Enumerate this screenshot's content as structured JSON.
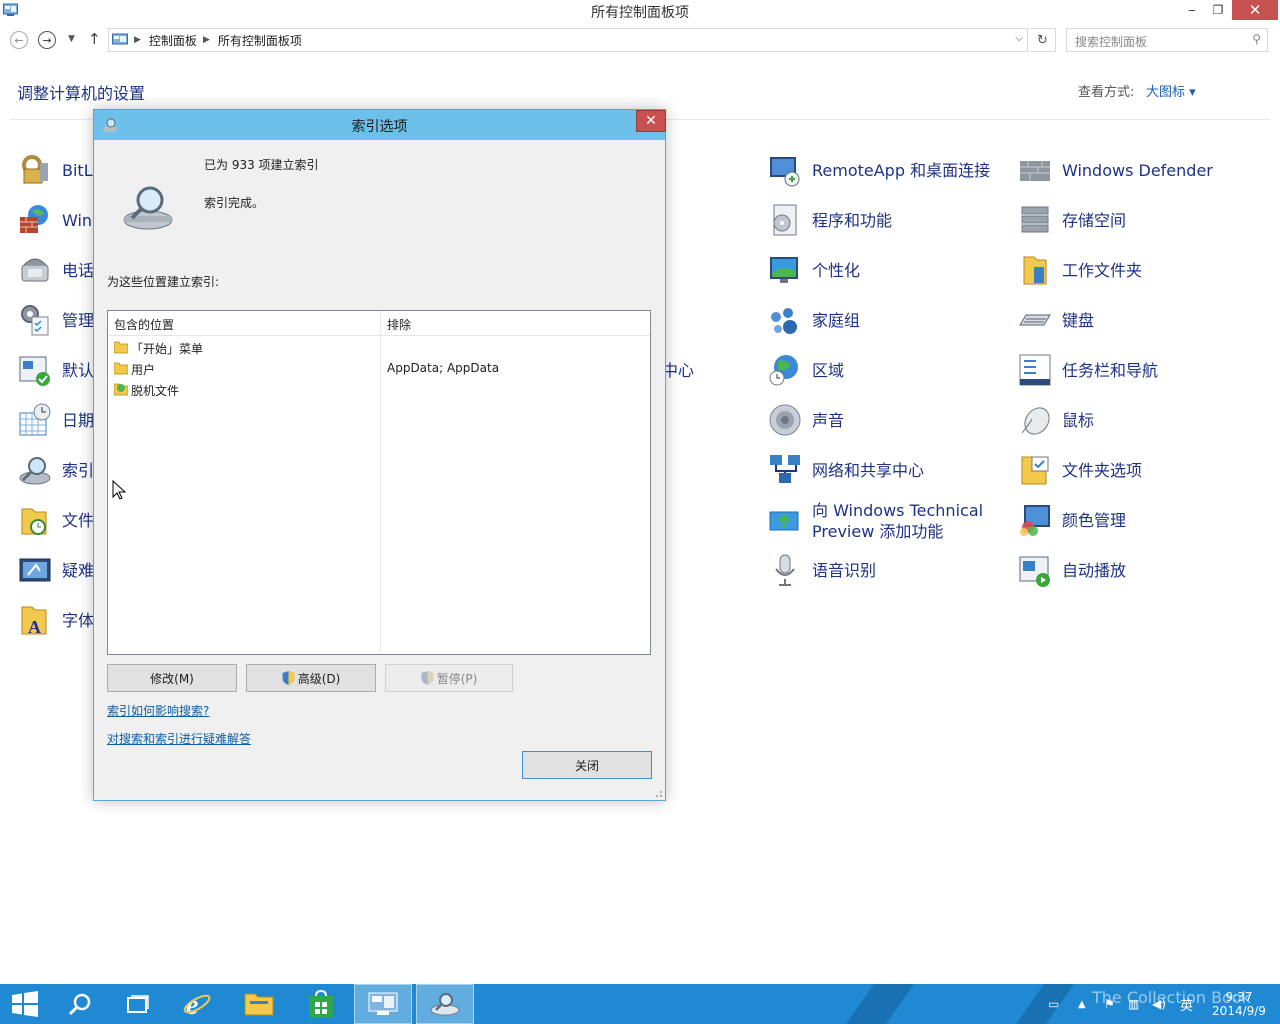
{
  "window": {
    "title": "所有控制面板项",
    "minimize": "‒",
    "maximize": "❐",
    "close": "✕"
  },
  "address": {
    "crumbs": [
      "控制面板",
      "所有控制面板项"
    ],
    "search_placeholder": "搜索控制面板"
  },
  "header": {
    "title": "调整计算机的设置",
    "view_by_label": "查看方式:",
    "view_by_value": "大图标 ▾"
  },
  "items_left": [
    {
      "label": "BitLo",
      "icon": "bitlocker-icon"
    },
    {
      "label": "Win",
      "icon": "firewall-icon"
    },
    {
      "label": "电话",
      "icon": "phone-icon"
    },
    {
      "label": "管理",
      "icon": "admin-tools-icon"
    },
    {
      "label": "默认",
      "icon": "default-programs-icon"
    },
    {
      "label": "日期",
      "icon": "date-time-icon"
    },
    {
      "label": "索引",
      "icon": "indexing-icon"
    },
    {
      "label": "文件",
      "icon": "file-history-icon"
    },
    {
      "label": "疑难",
      "icon": "troubleshoot-icon"
    },
    {
      "label": "字体",
      "icon": "fonts-icon"
    }
  ],
  "partial_center_label": "中心",
  "items_col3": [
    {
      "label": "RemoteApp 和桌面连接",
      "icon": "remoteapp-icon"
    },
    {
      "label": "程序和功能",
      "icon": "programs-icon"
    },
    {
      "label": "个性化",
      "icon": "personalization-icon"
    },
    {
      "label": "家庭组",
      "icon": "homegroup-icon"
    },
    {
      "label": "区域",
      "icon": "region-icon"
    },
    {
      "label": "声音",
      "icon": "sound-icon"
    },
    {
      "label": "网络和共享中心",
      "icon": "network-icon"
    },
    {
      "label": "向 Windows Technical Preview 添加功能",
      "icon": "add-features-icon"
    },
    {
      "label": "语音识别",
      "icon": "speech-icon"
    }
  ],
  "items_col4": [
    {
      "label": "Windows Defender",
      "icon": "defender-icon"
    },
    {
      "label": "存储空间",
      "icon": "storage-icon"
    },
    {
      "label": "工作文件夹",
      "icon": "work-folders-icon"
    },
    {
      "label": "键盘",
      "icon": "keyboard-icon"
    },
    {
      "label": "任务栏和导航",
      "icon": "taskbar-nav-icon"
    },
    {
      "label": "鼠标",
      "icon": "mouse-icon"
    },
    {
      "label": "文件夹选项",
      "icon": "folder-options-icon"
    },
    {
      "label": "颜色管理",
      "icon": "color-mgmt-icon"
    },
    {
      "label": "自动播放",
      "icon": "autoplay-icon"
    }
  ],
  "dialog": {
    "title": "索引选项",
    "close": "✕",
    "count_text": "已为 933 项建立索引",
    "status_text": "索引完成。",
    "locations_label": "为这些位置建立索引:",
    "col_included": "包含的位置",
    "col_excluded": "排除",
    "rows": [
      {
        "name": "「开始」菜单",
        "excluded": "",
        "icon": "folder-icon"
      },
      {
        "name": "用户",
        "excluded": "AppData; AppData",
        "icon": "folder-icon"
      },
      {
        "name": "脱机文件",
        "excluded": "",
        "icon": "offline-files-icon"
      }
    ],
    "modify": "修改(M)",
    "advanced": "高级(D)",
    "pause": "暂停(P)",
    "link1": "索引如何影响搜索?",
    "link2": "对搜索和索引进行疑难解答",
    "close_button": "关闭"
  },
  "taskbar": {
    "time": "9:37",
    "date": "2014/9/9",
    "ime": "英",
    "watermark": "The Collection Book"
  }
}
